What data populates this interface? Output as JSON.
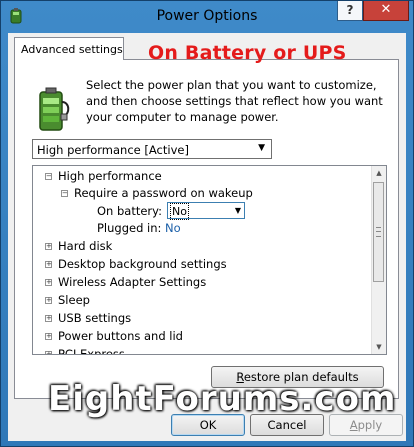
{
  "window": {
    "title": "Power Options",
    "help_glyph": "?",
    "close_glyph": "✕"
  },
  "tab": {
    "label": "Advanced settings"
  },
  "overlay": {
    "text": "On Battery or UPS"
  },
  "intro": {
    "text": "Select the power plan that you want to customize, and then choose settings that reflect how you want your computer to manage power."
  },
  "plan_select": {
    "value": "High performance [Active]"
  },
  "tree": {
    "plan": "High performance",
    "setting": "Require a password on wakeup",
    "on_battery_label": "On battery:",
    "on_battery_value": "No",
    "plugged_in_label": "Plugged in:",
    "plugged_in_value": "No",
    "items": [
      "Hard disk",
      "Desktop background settings",
      "Wireless Adapter Settings",
      "Sleep",
      "USB settings",
      "Power buttons and lid",
      "PCI Express"
    ]
  },
  "buttons": {
    "restore_first": "R",
    "restore_rest": "estore plan defaults",
    "ok": "OK",
    "cancel": "Cancel",
    "apply_first": "A",
    "apply_rest": "pply"
  },
  "watermark": {
    "text": "EightForums.com"
  },
  "colors": {
    "overlay": "#e41b1b",
    "link_value": "#1b5fa8",
    "frame": "#2f78b8",
    "close": "#c7423a"
  },
  "icons": {
    "app": "power-options-icon",
    "battery": "battery-plug-icon"
  }
}
